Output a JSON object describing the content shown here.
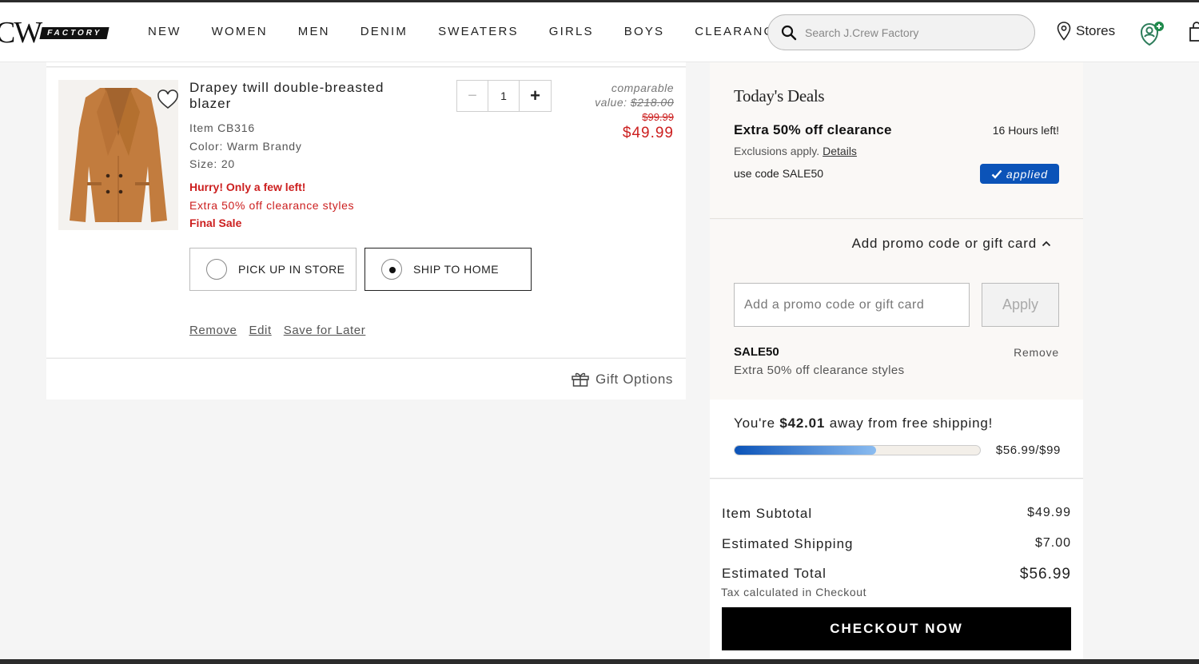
{
  "header": {
    "logo_mark": "CW",
    "logo_sub": "FACTORY",
    "nav": [
      "NEW",
      "WOMEN",
      "MEN",
      "DENIM",
      "SWEATERS",
      "GIRLS",
      "BOYS",
      "CLEARANCE"
    ],
    "search_placeholder": "Search J.Crew Factory",
    "stores_label": "Stores"
  },
  "cart_item": {
    "title": "Drapey twill double-breasted blazer",
    "item_no": "Item CB316",
    "color": "Color: Warm Brandy",
    "size": "Size: 20",
    "hurry": "Hurry! Only a few left!",
    "promo_note": "Extra 50% off clearance styles",
    "final_sale": "Final Sale",
    "quantity": "1",
    "comparable_label": "comparable",
    "comparable_value_label": "value:",
    "comparable_value": "$218.00",
    "old_price": "$99.99",
    "price": "$49.99",
    "pickup_label": "PICK UP IN STORE",
    "ship_home_label": "SHIP TO HOME",
    "selected_option": "ship_home",
    "links": {
      "remove": "Remove",
      "edit": "Edit",
      "save": "Save for Later"
    },
    "gift_options": "Gift Options",
    "image_color": "#c27c3e"
  },
  "deals": {
    "title": "Today's Deals",
    "name": "Extra 50% off clearance",
    "time_left": "16 Hours left!",
    "exclusions": "Exclusions apply.",
    "details_link": "Details",
    "code_line": "use code SALE50",
    "applied": "applied"
  },
  "promo": {
    "toggle_label": "Add promo code or gift card",
    "input_placeholder": "Add a promo code or gift card",
    "apply_label": "Apply",
    "applied_code": "SALE50",
    "remove_label": "Remove",
    "applied_desc": "Extra 50% off clearance styles"
  },
  "shipping_progress": {
    "msg_pre": "You're",
    "amount": "$42.01",
    "msg_post": "away from free shipping!",
    "fraction_text": "$56.99/$99",
    "progress": 0.5757
  },
  "summary": {
    "subtotal_label": "Item Subtotal",
    "subtotal": "$49.99",
    "shipping_label": "Estimated Shipping",
    "shipping": "$7.00",
    "total_label": "Estimated Total",
    "total": "$56.99",
    "tax_note": "Tax calculated in Checkout",
    "checkout_label": "CHECKOUT NOW"
  },
  "colors": {
    "sale_red": "#cc1f1f",
    "accent_blue": "#0b53b8",
    "panel_bg": "#faf8f6"
  }
}
